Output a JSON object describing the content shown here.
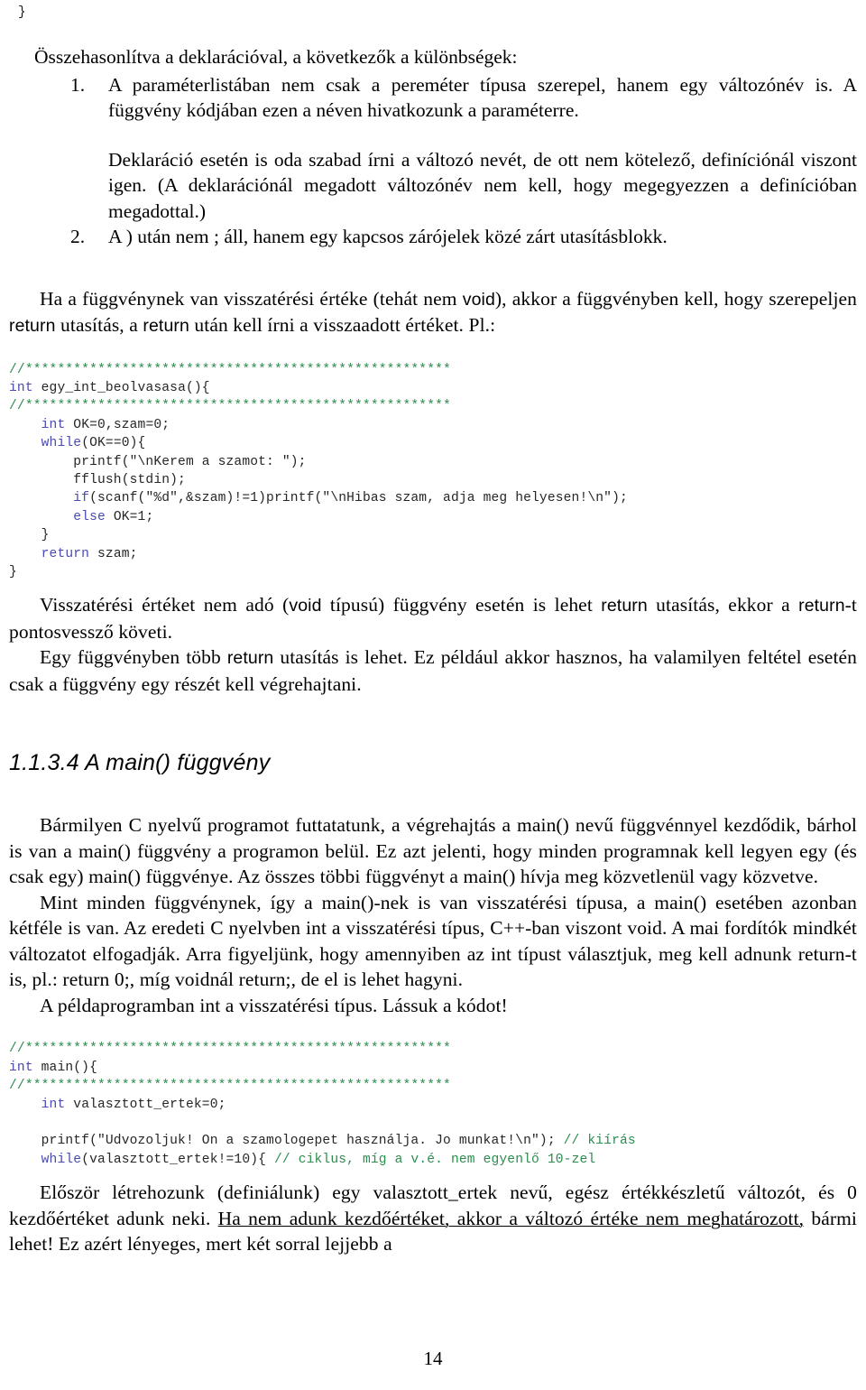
{
  "document": {
    "page_number": "14",
    "language": "hu"
  },
  "previous_block": {
    "closing_brace": "}"
  },
  "intro": {
    "lead": "Összehasonlítva a deklarációval, a következők a különbségek:"
  },
  "list": {
    "items": [
      {
        "marker": "1.",
        "text": "A paraméterlistában nem csak a pereméter típusa szerepel, hanem egy változónév is. A függvény kódjában ezen a néven hivatkozunk a paraméterre.",
        "sub": "Deklaráció esetén is oda szabad írni a változó nevét, de ott nem kötelező, definíciónál viszont igen. (A deklarációnál megadott változónév nem kell, hogy megegyezzen a definícióban megadottal.)"
      },
      {
        "marker": "2.",
        "text": "A ) után nem ; áll, hanem egy kapcsos zárójelek közé zárt utasításblokk.",
        "sub": ""
      }
    ]
  },
  "paragraphs": {
    "return_intro_a": "Ha a függvénynek van visszatérési értéke (tehát nem ",
    "return_intro_void": "void",
    "return_intro_b": "), akkor a függvényben kell, hogy szerepeljen ",
    "return_intro_kw1": "return",
    "return_intro_c": " utasítás, a ",
    "return_intro_kw2": "return",
    "return_intro_d": " után kell írni a visszaadott értéket. Pl.:",
    "void_return_a": "Visszatérési értéket nem adó (",
    "void_return_void": "void",
    "void_return_b": " típusú) függvény esetén is lehet ",
    "void_return_kw1": "return",
    "void_return_c": " utasítás, ekkor a ",
    "void_return_kw2": "return",
    "void_return_d": "-t pontosvessző követi.",
    "multi_return_a": "Egy függvényben több ",
    "multi_return_kw": "return",
    "multi_return_b": " utasítás is lehet. Ez például akkor hasznos, ha valamilyen feltétel esetén csak a függvény egy részét kell végrehajtani.",
    "main_p1": "Bármilyen C nyelvű programot futtatatunk, a végrehajtás a main() nevű függvénnyel kezdődik, bárhol is van a main() függvény a programon belül. Ez azt jelenti, hogy minden programnak kell legyen egy (és csak egy) main() függvénye. Az összes többi függvényt a main() hívja meg közvetlenül vagy közvetve.",
    "main_p2": "Mint minden függvénynek, így a main()-nek is van visszatérési típusa, a main() esetében azonban kétféle is van. Az eredeti C nyelvben int a visszatérési típus, C++-ban viszont void. A mai fordítók mindkét változatot elfogadják. Arra figyeljünk, hogy amennyiben az int típust választjuk, meg kell adnunk return-t is, pl.: return 0;, míg voidnál return;, de el is lehet hagyni.",
    "main_p3": "A példaprogramban int a visszatérési típus. Lássuk a kódot!",
    "final_a": "Először létrehozunk (definiálunk) egy valasztott_ertek nevű, egész értékkészletű változót, és 0 kezdőértéket adunk neki. ",
    "final_underlined": "Ha nem adunk kezdőértéket, akkor a változó értéke nem meghatározott,",
    "final_b": " bármi lehet! Ez azért lényeges, mert két sorral lejjebb a"
  },
  "heading": {
    "section": "1.1.3.4 A main() függvény"
  },
  "code_block_1": {
    "lines": [
      [
        {
          "t": "//*****************************************************",
          "c": "cm"
        }
      ],
      [
        {
          "t": "int",
          "c": "kw"
        },
        {
          "t": " egy_int_beolvasasa(){",
          "c": "pl"
        }
      ],
      [
        {
          "t": "//*****************************************************",
          "c": "cm"
        }
      ],
      [
        {
          "t": "    ",
          "c": "pl"
        },
        {
          "t": "int",
          "c": "kw"
        },
        {
          "t": " OK=0,szam=0;",
          "c": "pl"
        }
      ],
      [
        {
          "t": "    ",
          "c": "pl"
        },
        {
          "t": "while",
          "c": "kw"
        },
        {
          "t": "(OK==0){",
          "c": "pl"
        }
      ],
      [
        {
          "t": "        printf(\"\\nKerem a szamot: \");",
          "c": "pl"
        }
      ],
      [
        {
          "t": "        fflush(stdin);",
          "c": "pl"
        }
      ],
      [
        {
          "t": "        ",
          "c": "pl"
        },
        {
          "t": "if",
          "c": "kw"
        },
        {
          "t": "(scanf(\"%d\",&szam)!=1)printf(\"\\nHibas szam, adja meg helyesen!\\n\");",
          "c": "pl"
        }
      ],
      [
        {
          "t": "        ",
          "c": "pl"
        },
        {
          "t": "else",
          "c": "kw"
        },
        {
          "t": " OK=1;",
          "c": "pl"
        }
      ],
      [
        {
          "t": "    }",
          "c": "pl"
        }
      ],
      [
        {
          "t": "    ",
          "c": "pl"
        },
        {
          "t": "return",
          "c": "kw"
        },
        {
          "t": " szam;",
          "c": "pl"
        }
      ],
      [
        {
          "t": "}",
          "c": "pl"
        }
      ]
    ]
  },
  "code_block_2": {
    "lines": [
      [
        {
          "t": "//*****************************************************",
          "c": "cm"
        }
      ],
      [
        {
          "t": "int",
          "c": "kw"
        },
        {
          "t": " main(){",
          "c": "pl"
        }
      ],
      [
        {
          "t": "//*****************************************************",
          "c": "cm"
        }
      ],
      [
        {
          "t": "    ",
          "c": "pl"
        },
        {
          "t": "int",
          "c": "kw"
        },
        {
          "t": " valasztott_ertek=0;",
          "c": "pl"
        }
      ],
      [
        {
          "t": "",
          "c": "pl"
        }
      ],
      [
        {
          "t": "    printf(\"Udvozoljuk! On a szamologepet használja. Jo munkat!\\n\"); ",
          "c": "pl"
        },
        {
          "t": "// kiírás",
          "c": "cm"
        }
      ],
      [
        {
          "t": "    ",
          "c": "pl"
        },
        {
          "t": "while",
          "c": "kw"
        },
        {
          "t": "(valasztott_ertek!=10){ ",
          "c": "pl"
        },
        {
          "t": "// ciklus, míg a v.é. nem egyenlő 10-zel",
          "c": "cm"
        }
      ]
    ]
  },
  "colors": {
    "comment_green": "#2c8c4e",
    "keyword_blue": "#4a4ab4",
    "code_plain": "#262626",
    "body_text": "#000000",
    "page_background": "#ffffff"
  }
}
